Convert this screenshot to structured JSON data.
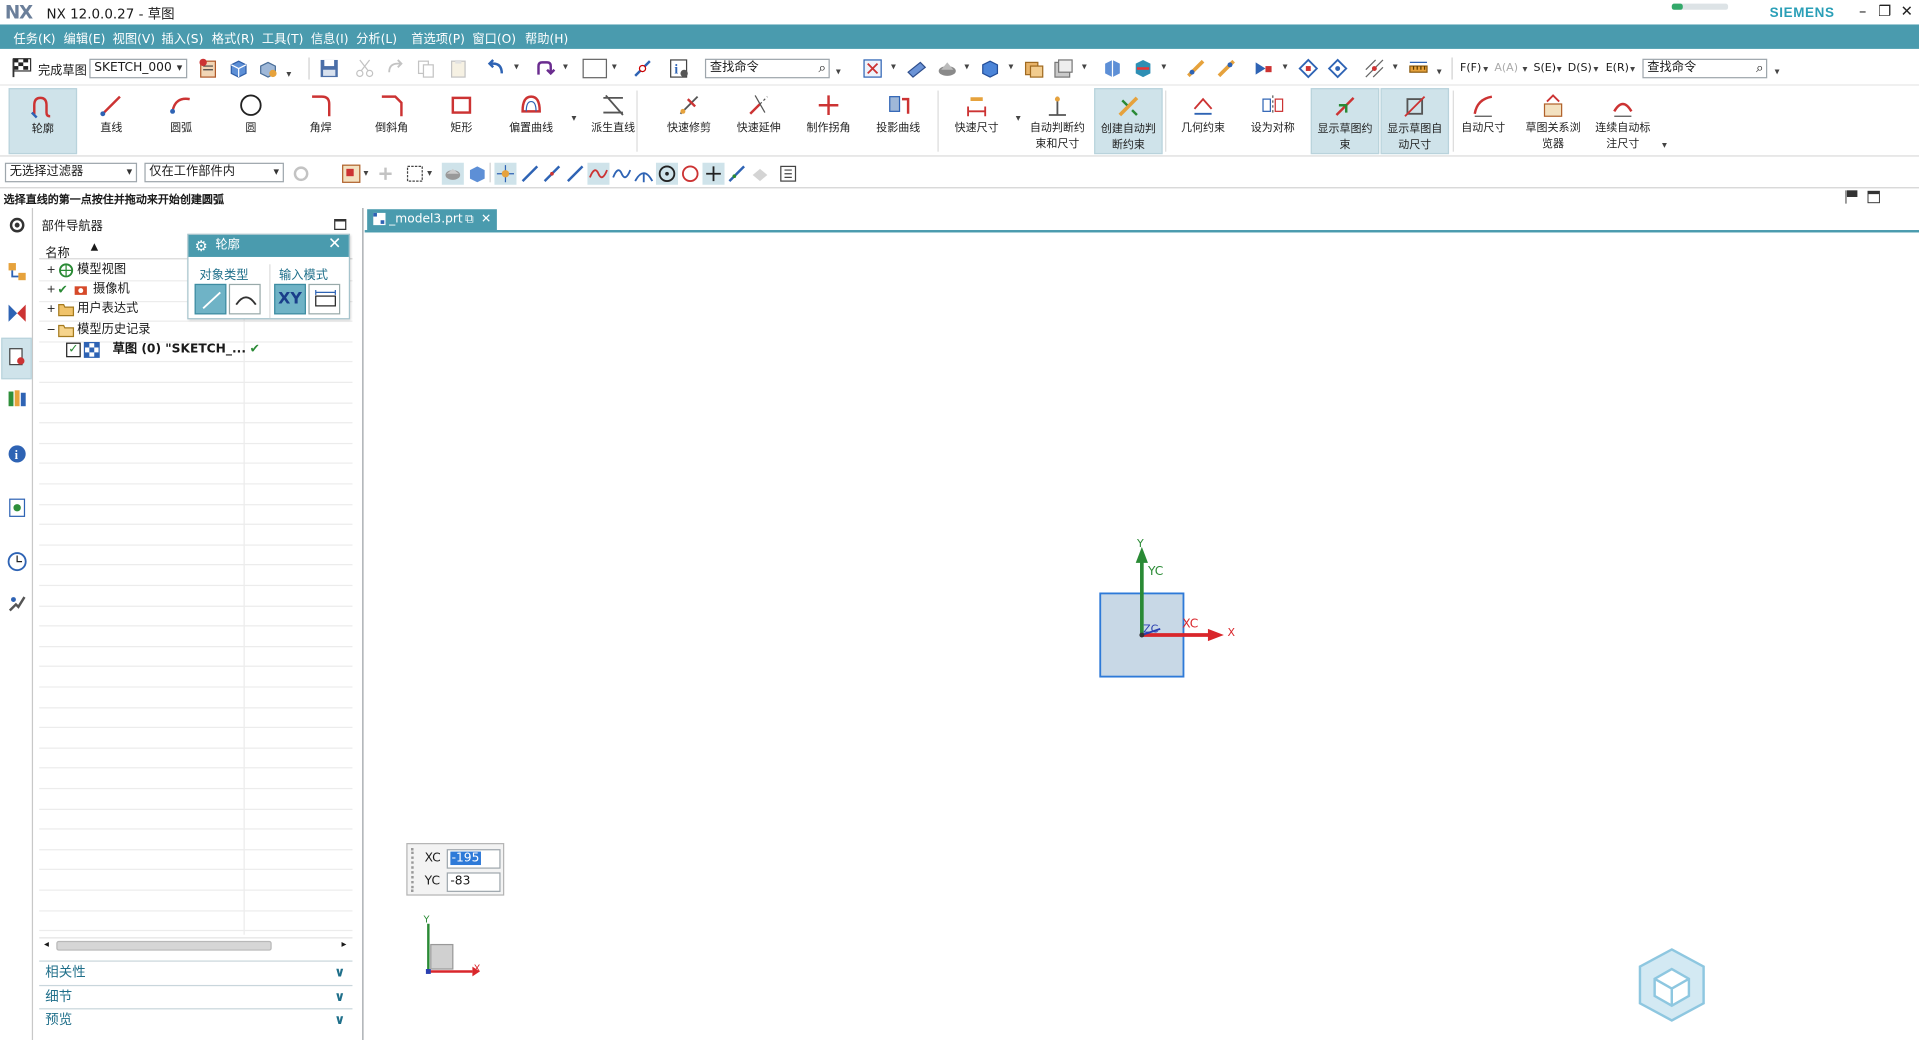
{
  "window": {
    "app_logo": "NX",
    "title": "NX 12.0.0.27 - 草图",
    "brand": "SIEMENS",
    "progress": 0.2
  },
  "menu": [
    "任务(K)",
    "编辑(E)",
    "视图(V)",
    "插入(S)",
    "格式(R)",
    "工具(T)",
    "信息(I)",
    "分析(L)",
    "首选项(P)",
    "窗口(O)",
    "帮助(H)"
  ],
  "toolbar1": {
    "finish_sketch": "完成草图",
    "sketch_name": "SKETCH_000",
    "search_placeholder": "查找命令",
    "filters": [
      "F(F)",
      "A(A)",
      "S(E)",
      "D(S)",
      "E(R)"
    ],
    "search2_placeholder": "查找命令"
  },
  "ribbon": [
    {
      "label": "轮廓",
      "icon": "profile-icon",
      "selected": true
    },
    {
      "label": "直线",
      "icon": "line-icon"
    },
    {
      "label": "圆弧",
      "icon": "arc-icon"
    },
    {
      "label": "圆",
      "icon": "circle-icon"
    },
    {
      "label": "角焊",
      "icon": "fillet-icon"
    },
    {
      "label": "倒斜角",
      "icon": "chamfer-icon"
    },
    {
      "label": "矩形",
      "icon": "rectangle-icon"
    },
    {
      "label": "偏置曲线",
      "icon": "offset-curve-icon"
    },
    {
      "label": "派生直线",
      "icon": "derived-line-icon"
    },
    {
      "label": "快速修剪",
      "icon": "quick-trim-icon"
    },
    {
      "label": "快速延伸",
      "icon": "quick-extend-icon"
    },
    {
      "label": "制作拐角",
      "icon": "make-corner-icon"
    },
    {
      "label": "投影曲线",
      "icon": "project-curve-icon"
    },
    {
      "label": "快速尺寸",
      "icon": "rapid-dimension-icon"
    },
    {
      "label": "自动判断约\n束和尺寸",
      "icon": "infer-constraints-icon"
    },
    {
      "label": "创建自动判\n断约束",
      "icon": "create-inferred-icon",
      "selected": true
    },
    {
      "label": "几何约束",
      "icon": "geometric-constraint-icon"
    },
    {
      "label": "设为对称",
      "icon": "make-symmetric-icon"
    },
    {
      "label": "显示草图约\n束",
      "icon": "show-constraints-icon",
      "selected": true
    },
    {
      "label": "显示草图自\n动尺寸",
      "icon": "show-auto-dim-icon",
      "selected": true
    },
    {
      "label": "自动尺寸",
      "icon": "auto-dimension-icon"
    },
    {
      "label": "草图关系浏\n览器",
      "icon": "relations-browser-icon"
    },
    {
      "label": "连续自动标\n注尺寸",
      "icon": "continuous-dim-icon"
    }
  ],
  "toolbar3": {
    "filter": "无选择过滤器",
    "scope": "仅在工作部件内"
  },
  "hint": "选择直线的第一点按住并拖动来开始创建圆弧",
  "navigator": {
    "title": "部件导航器",
    "column": "名称",
    "rows": [
      {
        "label": "模型视图",
        "level": 0
      },
      {
        "label": "摄像机",
        "level": 0
      },
      {
        "label": "用户表达式",
        "level": 0
      },
      {
        "label": "模型历史记录",
        "level": 0
      },
      {
        "label": "草图 (0) \"SKETCH_...",
        "level": 1
      }
    ],
    "sections": [
      "相关性",
      "细节",
      "预览"
    ]
  },
  "dialog": {
    "title": "轮廓",
    "object_type": "对象类型",
    "input_mode": "输入模式",
    "xy": "XY"
  },
  "tab": {
    "name": "_model3.prt"
  },
  "axes": {
    "y": "Y",
    "yc": "YC",
    "xc": "XC",
    "x": "X",
    "zc": "ZC"
  },
  "coords": {
    "xc_label": "XC",
    "xc_value": "-195",
    "yc_label": "YC",
    "yc_value": "-83"
  },
  "colors": {
    "accent": "#4a9bae",
    "x_axis": "#d9262b",
    "y_axis": "#2a8a35",
    "z_axis": "#2a3fb0"
  }
}
